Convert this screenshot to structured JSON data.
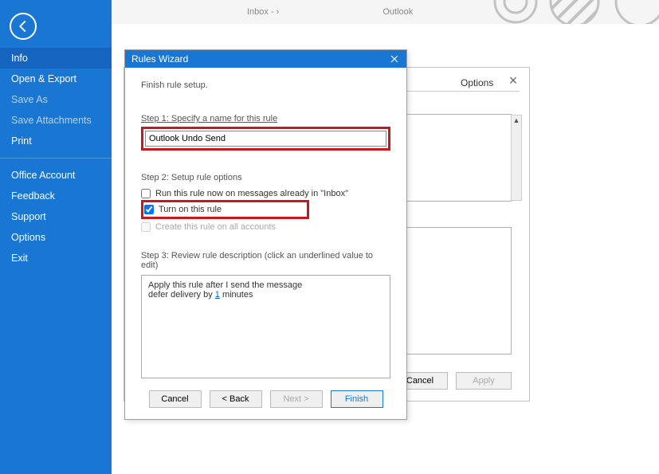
{
  "sidebar": {
    "items": [
      {
        "key": "info",
        "label": "Info",
        "active": true
      },
      {
        "key": "open-export",
        "label": "Open & Export"
      },
      {
        "key": "save-as",
        "label": "Save As",
        "disabled": true
      },
      {
        "key": "save-attachments",
        "label": "Save Attachments",
        "disabled": true
      },
      {
        "key": "print",
        "label": "Print"
      },
      {
        "key": "office-account",
        "label": "Office Account"
      },
      {
        "key": "feedback",
        "label": "Feedback"
      },
      {
        "key": "support",
        "label": "Support"
      },
      {
        "key": "options",
        "label": "Options"
      },
      {
        "key": "exit",
        "label": "Exit"
      }
    ]
  },
  "top": {
    "inbox": "Inbox - ›",
    "app": "Outlook"
  },
  "back_dialog": {
    "tabs": {
      "default": "",
      "options_label": "Options"
    },
    "cancel": "Cancel",
    "apply": "Apply"
  },
  "wizard": {
    "title": "Rules Wizard",
    "subtitle": "Finish rule setup.",
    "step1": {
      "label": "Step 1: Specify a name for this rule",
      "value": "Outlook Undo Send"
    },
    "step2": {
      "label": "Step 2: Setup rule options",
      "chk_run": "Run this rule now on messages already in \"Inbox\"",
      "chk_turn_on": "Turn on this rule",
      "chk_all_accounts": "Create this rule on all accounts"
    },
    "step3": {
      "label": "Step 3: Review rule description (click an underlined value to edit)",
      "line1": "Apply this rule after I send the message",
      "line2_prefix": "defer delivery by ",
      "line2_value": "1",
      "line2_suffix": " minutes"
    },
    "buttons": {
      "cancel": "Cancel",
      "back": "< Back",
      "next": "Next >",
      "finish": "Finish"
    }
  }
}
